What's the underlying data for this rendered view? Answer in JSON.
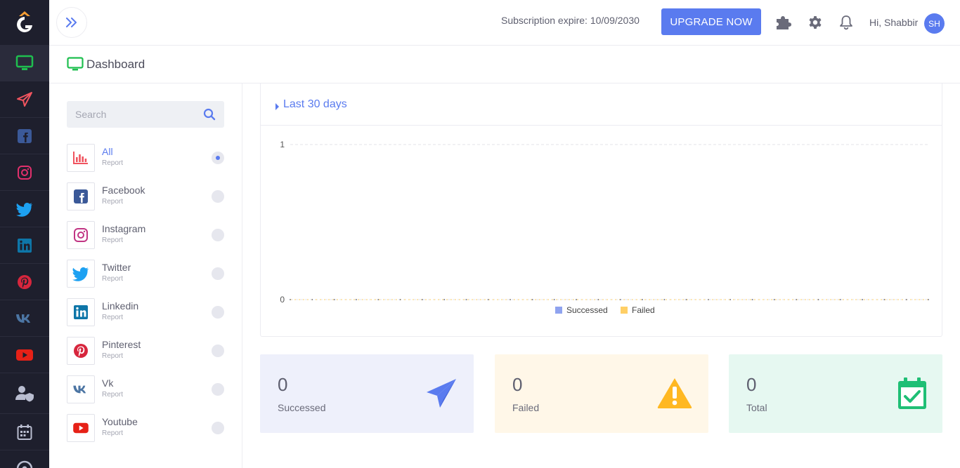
{
  "header": {
    "subscription_text": "Subscription expire: 10/09/2030",
    "upgrade_label": "UPGRADE NOW",
    "greeting": "Hi, Shabbir",
    "avatar_initials": "SH"
  },
  "page": {
    "title": "Dashboard"
  },
  "search": {
    "placeholder": "Search"
  },
  "reports": [
    {
      "name": "All",
      "sub": "Report",
      "icon": "bar-chart-icon",
      "active": true
    },
    {
      "name": "Facebook",
      "sub": "Report",
      "icon": "facebook-icon",
      "active": false
    },
    {
      "name": "Instagram",
      "sub": "Report",
      "icon": "instagram-icon",
      "active": false
    },
    {
      "name": "Twitter",
      "sub": "Report",
      "icon": "twitter-icon",
      "active": false
    },
    {
      "name": "Linkedin",
      "sub": "Report",
      "icon": "linkedin-icon",
      "active": false
    },
    {
      "name": "Pinterest",
      "sub": "Report",
      "icon": "pinterest-icon",
      "active": false
    },
    {
      "name": "Vk",
      "sub": "Report",
      "icon": "vk-icon",
      "active": false
    },
    {
      "name": "Youtube",
      "sub": "Report",
      "icon": "youtube-icon",
      "active": false
    }
  ],
  "chart": {
    "range_label": "Last 30 days"
  },
  "chart_data": {
    "type": "line",
    "ylim": [
      0,
      1
    ],
    "y_ticks": [
      "0",
      "1"
    ],
    "grid": true,
    "legend_placement": "bottom-center",
    "series": [
      {
        "name": "Successed",
        "color": "#8fa3ef",
        "values": [
          0,
          0,
          0,
          0,
          0,
          0,
          0,
          0,
          0,
          0,
          0,
          0,
          0,
          0,
          0,
          0,
          0,
          0,
          0,
          0,
          0,
          0,
          0,
          0,
          0,
          0,
          0,
          0,
          0,
          0
        ]
      },
      {
        "name": "Failed",
        "color": "#ffcf66",
        "values": [
          0,
          0,
          0,
          0,
          0,
          0,
          0,
          0,
          0,
          0,
          0,
          0,
          0,
          0,
          0,
          0,
          0,
          0,
          0,
          0,
          0,
          0,
          0,
          0,
          0,
          0,
          0,
          0,
          0,
          0
        ]
      }
    ]
  },
  "stats": [
    {
      "value": "0",
      "label": "Successed",
      "bg": "#eef0fb",
      "icon": "paper-plane-icon",
      "icon_color": "#5a7bef"
    },
    {
      "value": "0",
      "label": "Failed",
      "bg": "#fff7e8",
      "icon": "warning-icon",
      "icon_color": "#ffb822"
    },
    {
      "value": "0",
      "label": "Total",
      "bg": "#e6f8f1",
      "icon": "calendar-check-icon",
      "icon_color": "#1fbf75"
    }
  ],
  "colors": {
    "accent": "#5a7bef",
    "rail_bg": "#1e1f2d",
    "dashboard_green": "#1fbf4f"
  }
}
